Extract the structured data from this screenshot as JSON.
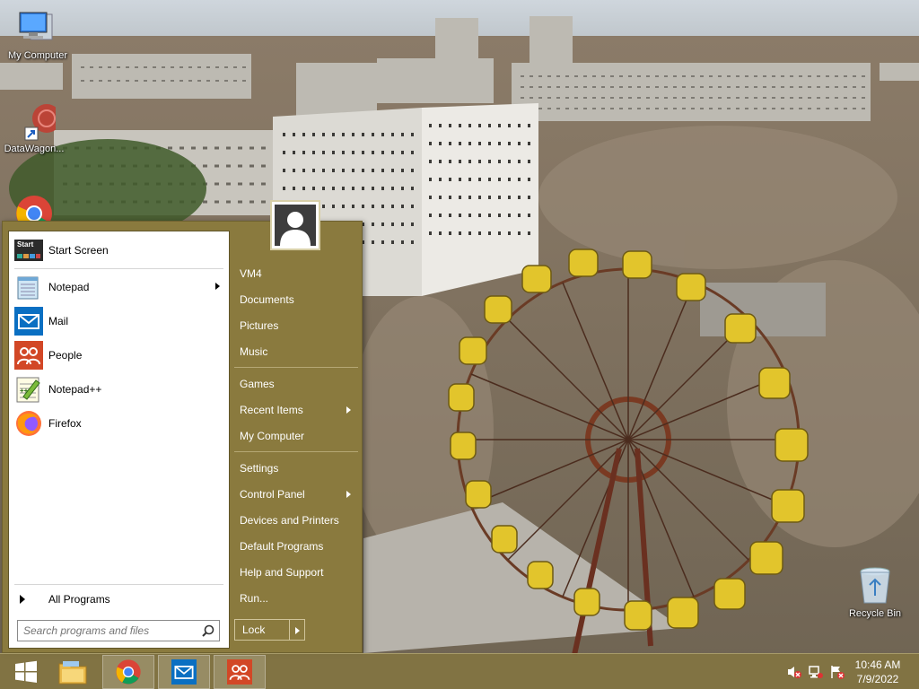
{
  "desktop": {
    "icons": [
      {
        "label": "My Computer"
      },
      {
        "label": "DataWagon..."
      },
      {
        "label": "Recycle Bin"
      }
    ]
  },
  "start_menu": {
    "pinned": [
      {
        "label": "Start Screen",
        "icon": "start-screen-icon",
        "badge": "Start"
      },
      {
        "label": "Notepad",
        "icon": "notepad-icon",
        "has_submenu": true
      },
      {
        "label": "Mail",
        "icon": "mail-icon"
      },
      {
        "label": "People",
        "icon": "people-icon"
      },
      {
        "label": "Notepad++",
        "icon": "notepadpp-icon"
      },
      {
        "label": "Firefox",
        "icon": "firefox-icon"
      }
    ],
    "all_programs": "All Programs",
    "search": {
      "placeholder": "Search programs and files",
      "value": ""
    },
    "right_items": [
      {
        "label": "VM4"
      },
      {
        "label": "Documents"
      },
      {
        "label": "Pictures"
      },
      {
        "label": "Music"
      },
      {
        "label": "Games"
      },
      {
        "label": "Recent Items",
        "has_submenu": true
      },
      {
        "label": "My Computer"
      },
      {
        "label": "Settings"
      },
      {
        "label": "Control Panel",
        "has_submenu": true
      },
      {
        "label": "Devices and Printers"
      },
      {
        "label": "Default Programs"
      },
      {
        "label": "Help and Support"
      },
      {
        "label": "Run..."
      }
    ],
    "power_button": "Lock"
  },
  "taskbar": {
    "buttons": [
      {
        "name": "start-button",
        "icon": "windows-logo-icon"
      },
      {
        "name": "file-explorer",
        "icon": "folder-icon"
      },
      {
        "name": "chrome",
        "icon": "chrome-icon"
      },
      {
        "name": "mail",
        "icon": "mail-icon"
      },
      {
        "name": "people",
        "icon": "people-icon"
      }
    ],
    "tray": {
      "icons": [
        "volume-muted-icon",
        "network-icon",
        "action-center-alert-icon"
      ],
      "time": "10:46 AM",
      "date": "7/9/2022"
    }
  },
  "colors": {
    "menu_accent": "#8a7a3e",
    "taskbar": "#827442"
  }
}
